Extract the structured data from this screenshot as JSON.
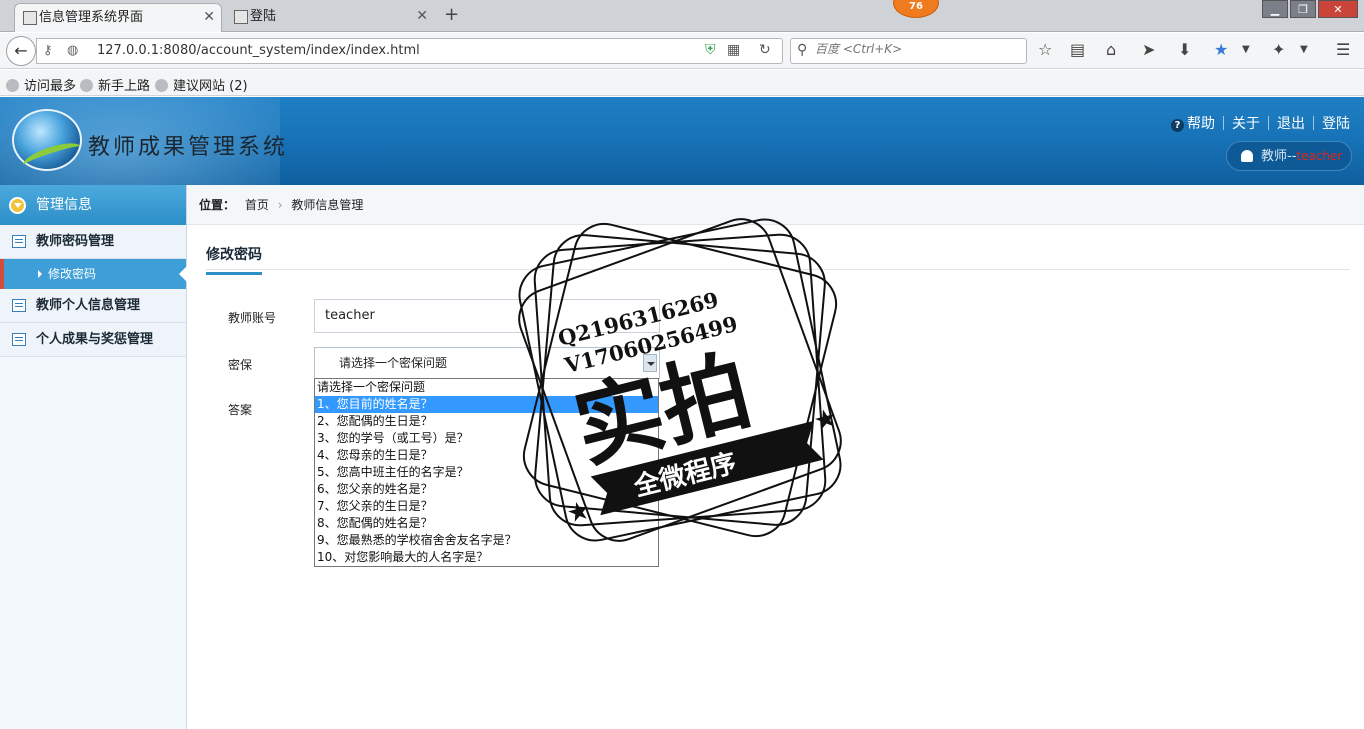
{
  "browser": {
    "tabs": [
      {
        "label": "信息管理系统界面",
        "active": true
      },
      {
        "label": "登陆",
        "active": false
      }
    ],
    "notification_badge": "76",
    "url": "127.0.0.1:8080/account_system/index/index.html",
    "search_placeholder": "百度 <Ctrl+K>",
    "bookmarks": [
      "访问最多",
      "新手上路",
      "建议网站 (2)"
    ]
  },
  "header": {
    "title": "教师成果管理系统",
    "links": {
      "help": "帮助",
      "about": "关于",
      "logout": "退出",
      "login": "登陆"
    },
    "user_role": "教师--",
    "user_name": "teacher"
  },
  "sidebar": {
    "title": "管理信息",
    "items": [
      {
        "label": "教师密码管理"
      },
      {
        "label": "修改密码",
        "sub": true,
        "active": true
      },
      {
        "label": "教师个人信息管理"
      },
      {
        "label": "个人成果与奖惩管理"
      }
    ]
  },
  "breadcrumb": {
    "prefix": "位置：",
    "home": "首页",
    "current": "教师信息管理"
  },
  "page": {
    "tab": "修改密码",
    "fields": {
      "account_label": "教师账号",
      "account_value": "teacher",
      "security_label": "密保",
      "security_selected": "请选择一个密保问题",
      "answer_label": "答案"
    },
    "dropdown_options": [
      "请选择一个密保问题",
      "1、您目前的姓名是？",
      "2、您配偶的生日是？",
      "3、您的学号（或工号）是？",
      "4、您母亲的生日是？",
      "5、您高中班主任的名字是？",
      "6、您父亲的姓名是？",
      "7、您父亲的生日是？",
      "8、您配偶的姓名是？",
      "9、您最熟悉的学校宿舍舍友名字是？",
      "10、对您影响最大的人名字是？"
    ],
    "dropdown_highlighted": 1
  },
  "watermark": {
    "line1": "Q2196316269",
    "line2": "V17060256499",
    "main": "实拍",
    "banner": "全微程序"
  },
  "colors": {
    "header_blue": "#1873b8",
    "accent_blue": "#2d8fc8",
    "highlight": "#3399ff",
    "sub_active": "#3e9fd8"
  }
}
